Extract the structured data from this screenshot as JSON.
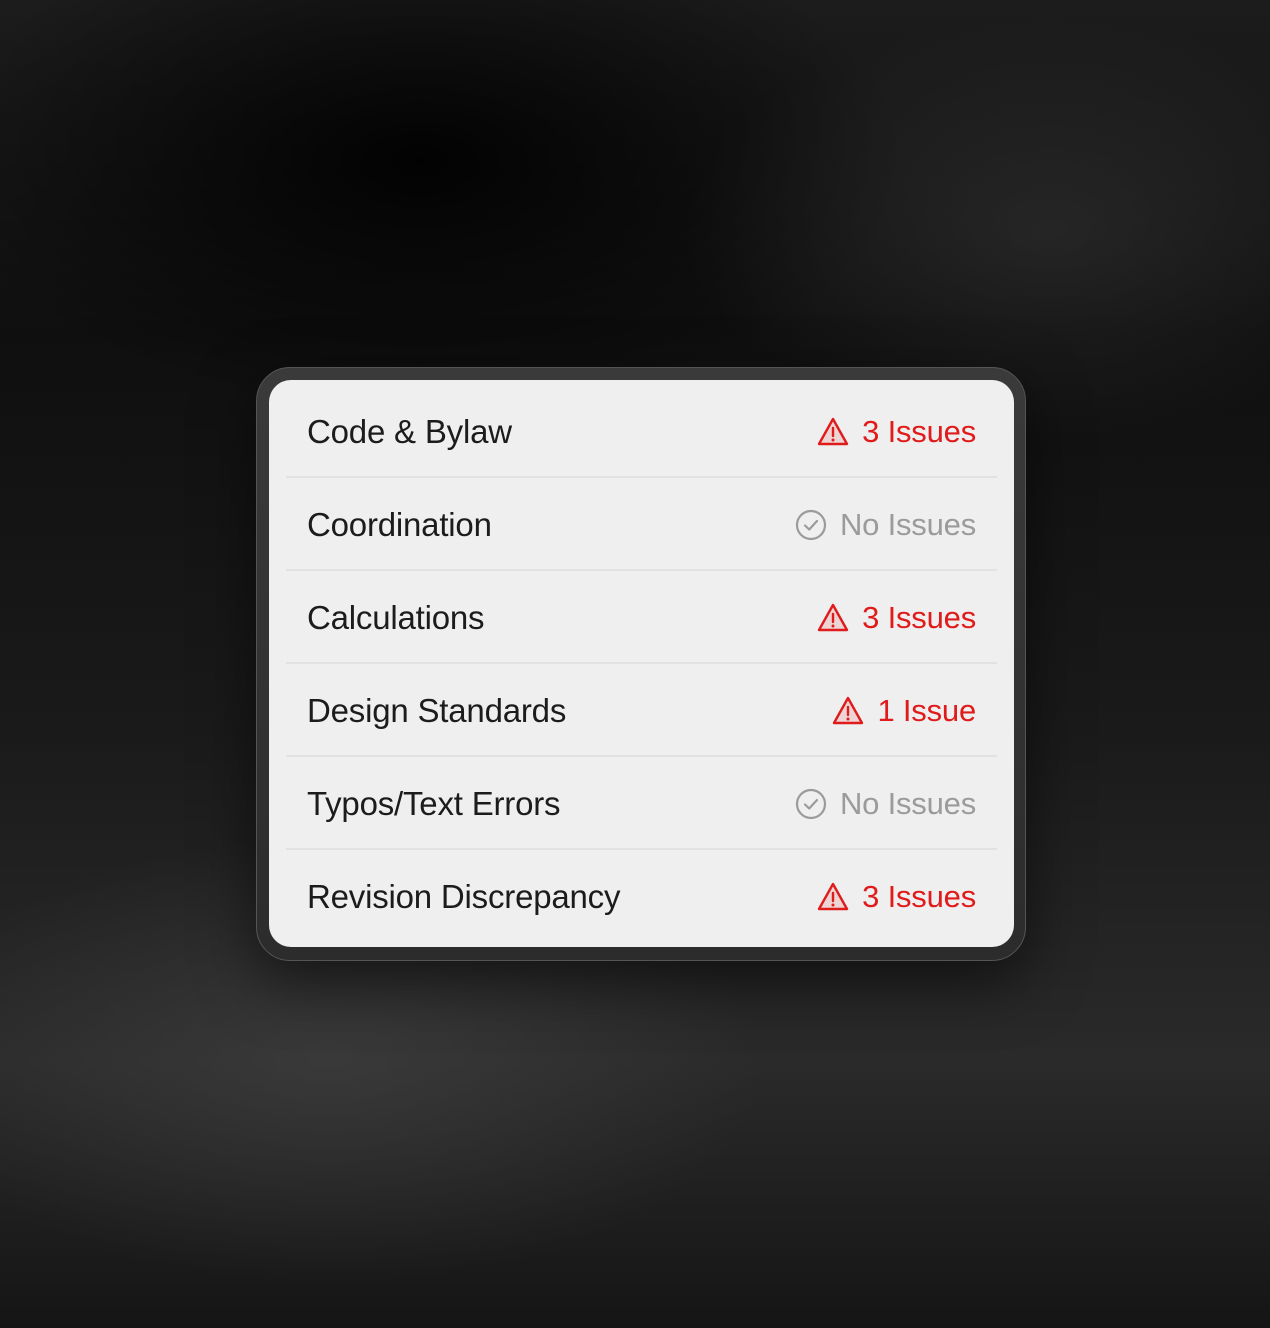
{
  "colors": {
    "issue": "#e01b1b",
    "ok": "#9b9b9b",
    "label": "#1c1c1c",
    "card": "#efefef"
  },
  "checks": [
    {
      "label": "Code & Bylaw",
      "status": "3 Issues",
      "state": "issue",
      "icon": "warning-triangle-icon"
    },
    {
      "label": "Coordination",
      "status": "No Issues",
      "state": "ok",
      "icon": "check-circle-icon"
    },
    {
      "label": "Calculations",
      "status": "3 Issues",
      "state": "issue",
      "icon": "warning-triangle-icon"
    },
    {
      "label": "Design Standards",
      "status": "1 Issue",
      "state": "issue",
      "icon": "warning-triangle-icon"
    },
    {
      "label": "Typos/Text Errors",
      "status": "No Issues",
      "state": "ok",
      "icon": "check-circle-icon"
    },
    {
      "label": "Revision Discrepancy",
      "status": "3 Issues",
      "state": "issue",
      "icon": "warning-triangle-icon"
    }
  ]
}
